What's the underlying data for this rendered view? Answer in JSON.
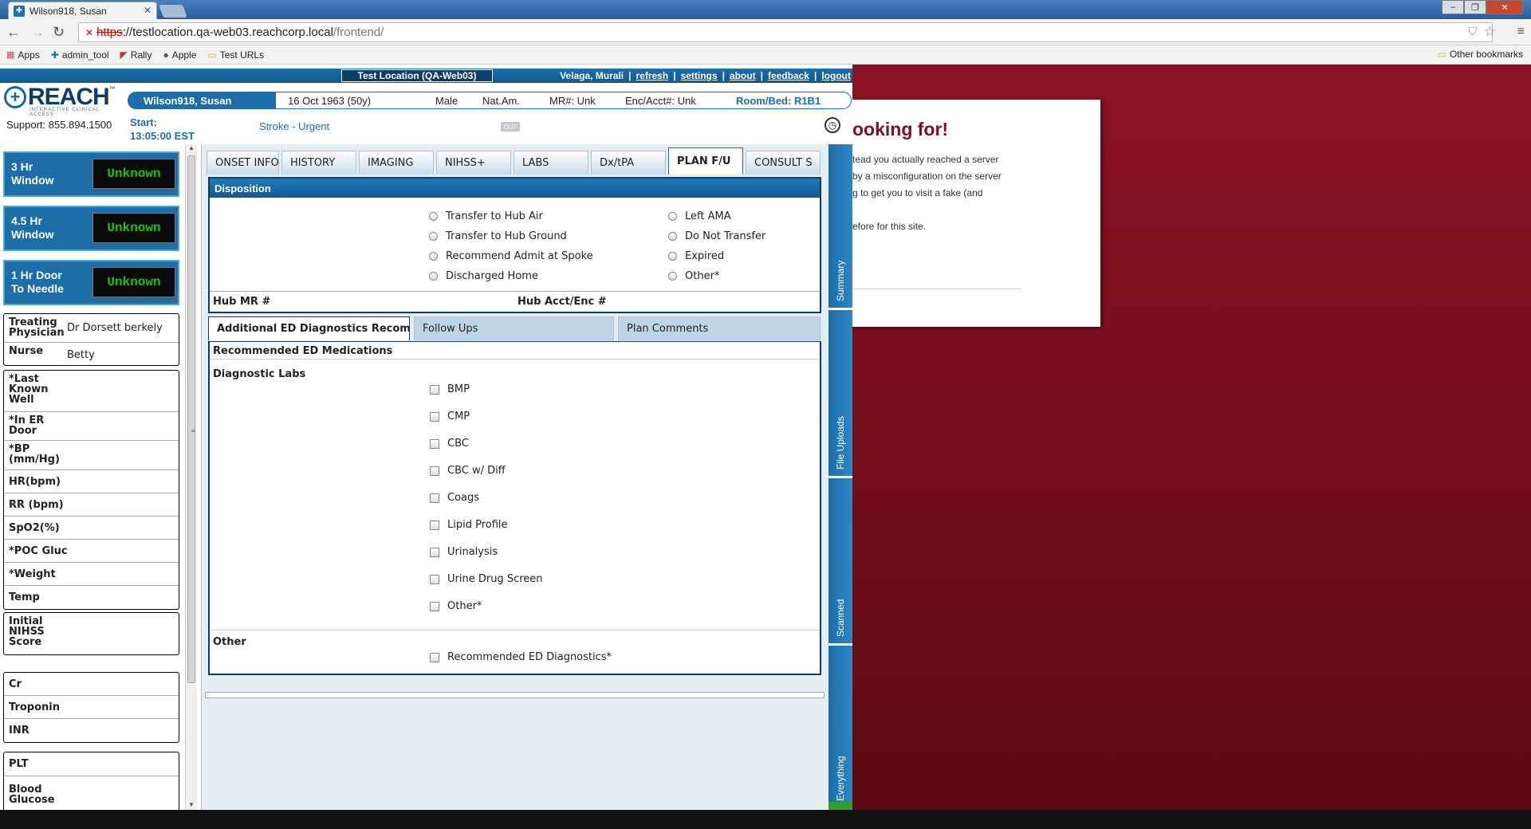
{
  "browser": {
    "tab_title": "Wilson918, Susan",
    "url_scheme": "https",
    "url_host": "://testlocation.qa-web03.reachcorp.local",
    "url_path": "/frontend/",
    "bookmarks": [
      "Apps",
      "admin_tool",
      "Rally",
      "Apple",
      "Test URLs"
    ],
    "other_bookmarks": "Other bookmarks"
  },
  "error_page": {
    "title": "ooking for!",
    "lines": [
      "tead you actually reached a server",
      " by a misconfiguration on the server",
      "g to get you to visit a fake (and",
      "",
      "efore for this site."
    ]
  },
  "topbar": {
    "location": "Test Location (QA-Web03)",
    "user": "Velaga, Murali",
    "links": [
      "refresh",
      "settings",
      "about",
      "feedback",
      "logout"
    ]
  },
  "logo": {
    "text": "REACH",
    "tm": "™",
    "sub": "INTERACTIVE CLINICAL ACCESS"
  },
  "patient": {
    "name": "Wilson918, Susan",
    "dob": "16 Oct 1963 (50y)",
    "sex": "Male",
    "ethnicity": "Nat.Am.",
    "mr": "MR#: Unk",
    "enc": "Enc/Acct#: Unk",
    "room": "Room/Bed: R1B1"
  },
  "header": {
    "support": "Support: 855.894.1500",
    "start_label": "Start:",
    "start_time": "13:05:00 EST",
    "stroke": "Stroke - Urgent",
    "out_badge": "OUT"
  },
  "windows": [
    {
      "label1": "3 Hr",
      "label2": "Window",
      "value": "Unknown"
    },
    {
      "label1": "4.5 Hr",
      "label2": "Window",
      "value": "Unknown"
    },
    {
      "label1": "1 Hr Door",
      "label2": "To Needle",
      "value": "Unknown"
    }
  ],
  "staff": {
    "physician_label1": "Treating",
    "physician_label2": "Physician",
    "physician": "Dr Dorsett berkely",
    "nurse_label": "Nurse",
    "nurse": "Betty"
  },
  "vitals": {
    "lkw1": "*Last",
    "lkw2": "Known",
    "lkw3": "Well",
    "door1": "*In ER",
    "door2": "Door",
    "bp1": "*BP",
    "bp2": "(mm/Hg)",
    "hr": "HR(bpm)",
    "rr": "RR (bpm)",
    "spo2": "SpO2(%)",
    "gluc": "*POC Gluc",
    "weight": "*Weight",
    "temp": "Temp"
  },
  "nihss": {
    "l1": "Initial",
    "l2": "NIHSS",
    "l3": "Score"
  },
  "labs_side": {
    "cr": "Cr",
    "troponin": "Troponin",
    "inr": "INR",
    "plt": "PLT",
    "bg1": "Blood",
    "bg2": "Glucose"
  },
  "tabs": [
    "ONSET INFO",
    "HISTORY",
    "IMAGING",
    "NIHSS+",
    "LABS",
    "Dx/tPA",
    "PLAN F/U",
    "CONSULT S"
  ],
  "disposition": {
    "header": "Disposition",
    "options_left": [
      "Transfer to Hub Air",
      "Transfer to Hub Ground",
      "Recommend Admit at Spoke",
      "Discharged Home"
    ],
    "options_right": [
      "Left AMA",
      "Do Not Transfer",
      "Expired",
      "Other*"
    ],
    "hub_mr": "Hub MR #",
    "hub_acct": "Hub Acct/Enc #"
  },
  "subtabs": [
    "Additional ED Diagnostics Recomme",
    "Follow Ups",
    "Plan Comments"
  ],
  "diagnostics": {
    "med_label": "Recommended ED Medications",
    "labs_label": "Diagnostic Labs",
    "labs": [
      "BMP",
      "CMP",
      "CBC",
      "CBC w/ Diff",
      "Coags",
      "Lipid Profile",
      "Urinalysis",
      "Urine Drug Screen",
      "Other*"
    ],
    "other_label": "Other",
    "other_item": "Recommended ED Diagnostics*"
  },
  "vtabs": [
    "Summary",
    "File Uploads",
    "Scanned",
    "Everything"
  ]
}
